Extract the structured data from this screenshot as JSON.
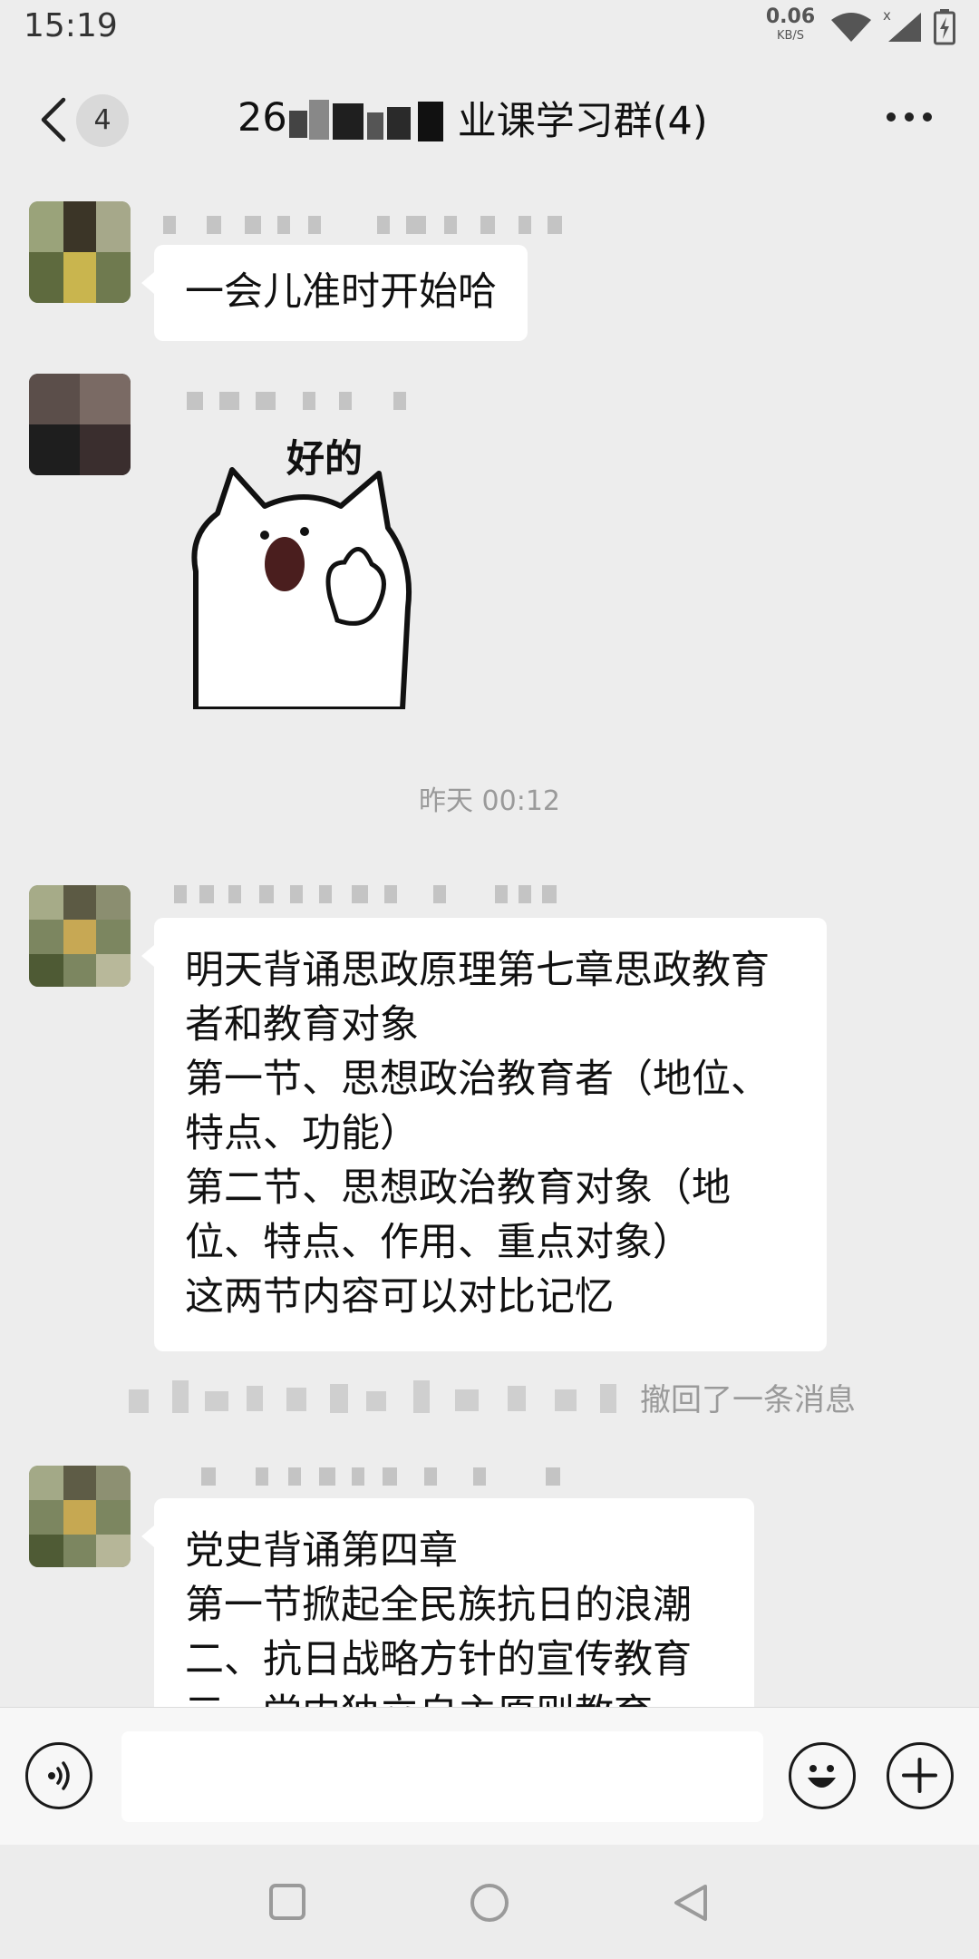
{
  "status_bar": {
    "time": "15:19",
    "net_speed_value": "0.06",
    "net_speed_unit": "KB/S",
    "icons": [
      "wifi-icon",
      "signal-icon",
      "battery-icon"
    ]
  },
  "header": {
    "unread_count": "4",
    "title_prefix": "26",
    "title_suffix": "业课学习群(4)",
    "icons": [
      "back-icon",
      "more-icon"
    ]
  },
  "messages": [
    {
      "type": "text",
      "text": "一会儿准时开始哈"
    },
    {
      "type": "sticker",
      "text": "好的"
    },
    {
      "type": "timestamp",
      "text": "昨天 00:12"
    },
    {
      "type": "text",
      "text": "明天背诵思政原理第七章思政教育\n者和教育对象\n第一节、思想政治教育者（地位、\n特点、功能）\n第二节、思想政治教育对象（地\n位、特点、作用、重点对象）\n这两节内容可以对比记忆"
    },
    {
      "type": "recall",
      "text": "撤回了一条消息"
    },
    {
      "type": "text",
      "text": "党史背诵第四章\n第一节掀起全民族抗日的浪潮\n二、抗日战略方针的宣传教育\n三、党内独立自主原则教育"
    }
  ],
  "input_bar": {
    "icons": [
      "voice-icon",
      "emoji-icon",
      "plus-icon"
    ]
  },
  "nav_bar": {
    "icons": [
      "recent-apps-icon",
      "home-icon",
      "back-triangle-icon"
    ]
  },
  "colors": {
    "background": "#ededed",
    "bubble": "#ffffff",
    "muted_text": "#9a9a9a"
  }
}
